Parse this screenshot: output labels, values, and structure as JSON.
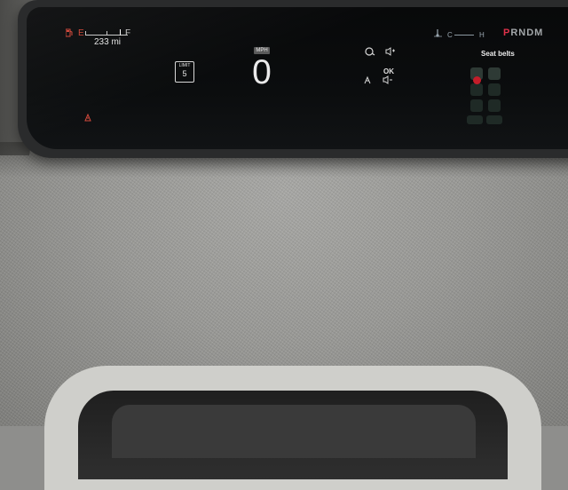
{
  "cluster": {
    "fuel": {
      "empty_label": "E",
      "full_label": "F",
      "range": "233 mi",
      "level": 0.9
    },
    "speed_limit": {
      "label": "LIMIT",
      "value": "5"
    },
    "speed": {
      "unit": "MPH",
      "value": "0"
    },
    "center_panel": {
      "ok_label": "OK"
    },
    "temperature": {
      "cold_label": "C",
      "hot_label": "H"
    },
    "gear_selector": {
      "active": "P",
      "others": "RNDM"
    },
    "seat_belts": {
      "title": "Seat belts",
      "alert_seat": "rear-left"
    }
  },
  "colors": {
    "warning_red": "#d24a3c",
    "gear_active": "#e0314a",
    "display_text": "#e6e6e6",
    "belt_ok": "#1f2a26"
  },
  "icons": [
    "fuel-pump-icon",
    "gear-warning-icon",
    "steering-assist-icon",
    "volume-up-icon",
    "volume-down-icon",
    "driver-assist-icon",
    "thermometer-icon",
    "seat-belt-alert-icon"
  ]
}
